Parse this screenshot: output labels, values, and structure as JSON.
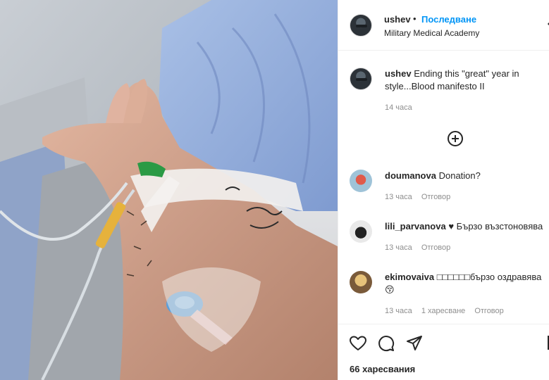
{
  "post": {
    "username": "ushev",
    "separator": "•",
    "follow_label": "Последване",
    "location": "Military Medical Academy",
    "more_icon": "more-options-icon"
  },
  "caption": {
    "username": "ushev",
    "text_line1": "Ending this \"great\" year in",
    "text_line2": "style...Blood manifesto II",
    "time": "14 часа"
  },
  "load_more_icon": "plus-circle-icon",
  "comments": [
    {
      "username": "doumanova",
      "text": "Donation?",
      "time": "13 часа",
      "reply": "Отговор"
    },
    {
      "username": "lili_parvanova",
      "text": "♥ Бързо възстоновява",
      "time": "13 часа",
      "reply": "Отговор"
    },
    {
      "username": "ekimovaiva",
      "text": "□□□□□□бързо оздравява",
      "text_line2": "😚",
      "time": "13 часа",
      "likes": "1 харесване",
      "reply": "Отговор"
    }
  ],
  "actions": {
    "like_icon": "heart-icon",
    "comment_icon": "comment-icon",
    "share_icon": "share-icon",
    "likes_text": "66 харесвания"
  },
  "photo_icon": "post-photo",
  "colors": {
    "follow_blue": "#0095f6",
    "text": "#262626",
    "muted": "#8e8e8e",
    "border": "#efefef"
  }
}
